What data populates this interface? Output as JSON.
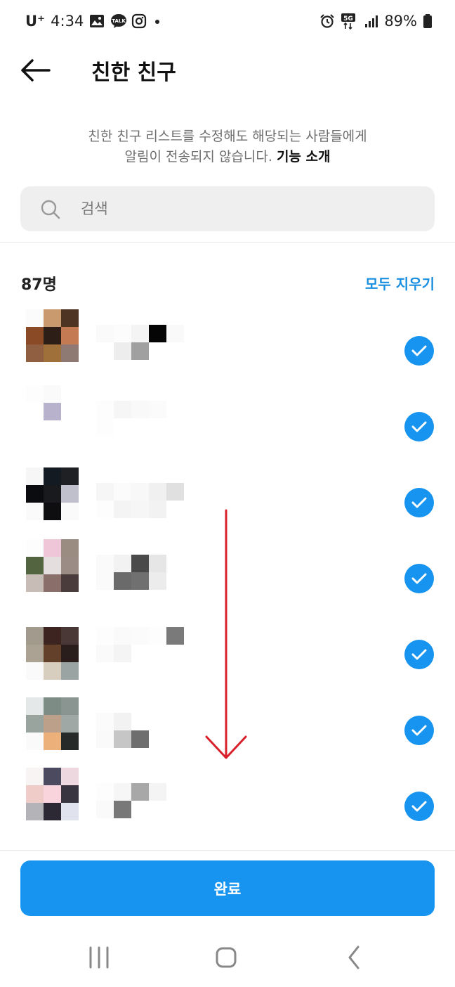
{
  "status_bar": {
    "carrier": "U⁺",
    "time": "4:34",
    "left_icons": [
      "gallery-icon",
      "kakaotalk-icon",
      "instagram-icon",
      "dot-icon"
    ],
    "right_icons": [
      "alarm-icon",
      "5g-icon",
      "signal-icon",
      "battery-icon"
    ],
    "network": "5G",
    "battery": "89%"
  },
  "header": {
    "back_icon": "arrow-left-icon",
    "title": "친한 친구"
  },
  "info": {
    "line1": "친한 친구 리스트를 수정해도 해당되는 사람들에게",
    "line2": "알림이 전송되지 않습니다.",
    "link": "기능 소개"
  },
  "search": {
    "placeholder": "검색",
    "value": ""
  },
  "list_header": {
    "count": "87명",
    "clear_all": "모두 지우기"
  },
  "friends": [
    {
      "name": "",
      "selected": true
    },
    {
      "name": "",
      "selected": true
    },
    {
      "name": "",
      "selected": true
    },
    {
      "name": "",
      "selected": true
    },
    {
      "name": "",
      "selected": true
    },
    {
      "name": "",
      "selected": true
    },
    {
      "name": "",
      "selected": true
    }
  ],
  "done_button": {
    "label": "완료"
  },
  "nav_bar": {
    "items": [
      "recent-apps-icon",
      "home-icon",
      "back-icon"
    ]
  },
  "colors": {
    "accent": "#1694f0",
    "link": "#1a8fe0",
    "annotation": "#d9202a"
  }
}
